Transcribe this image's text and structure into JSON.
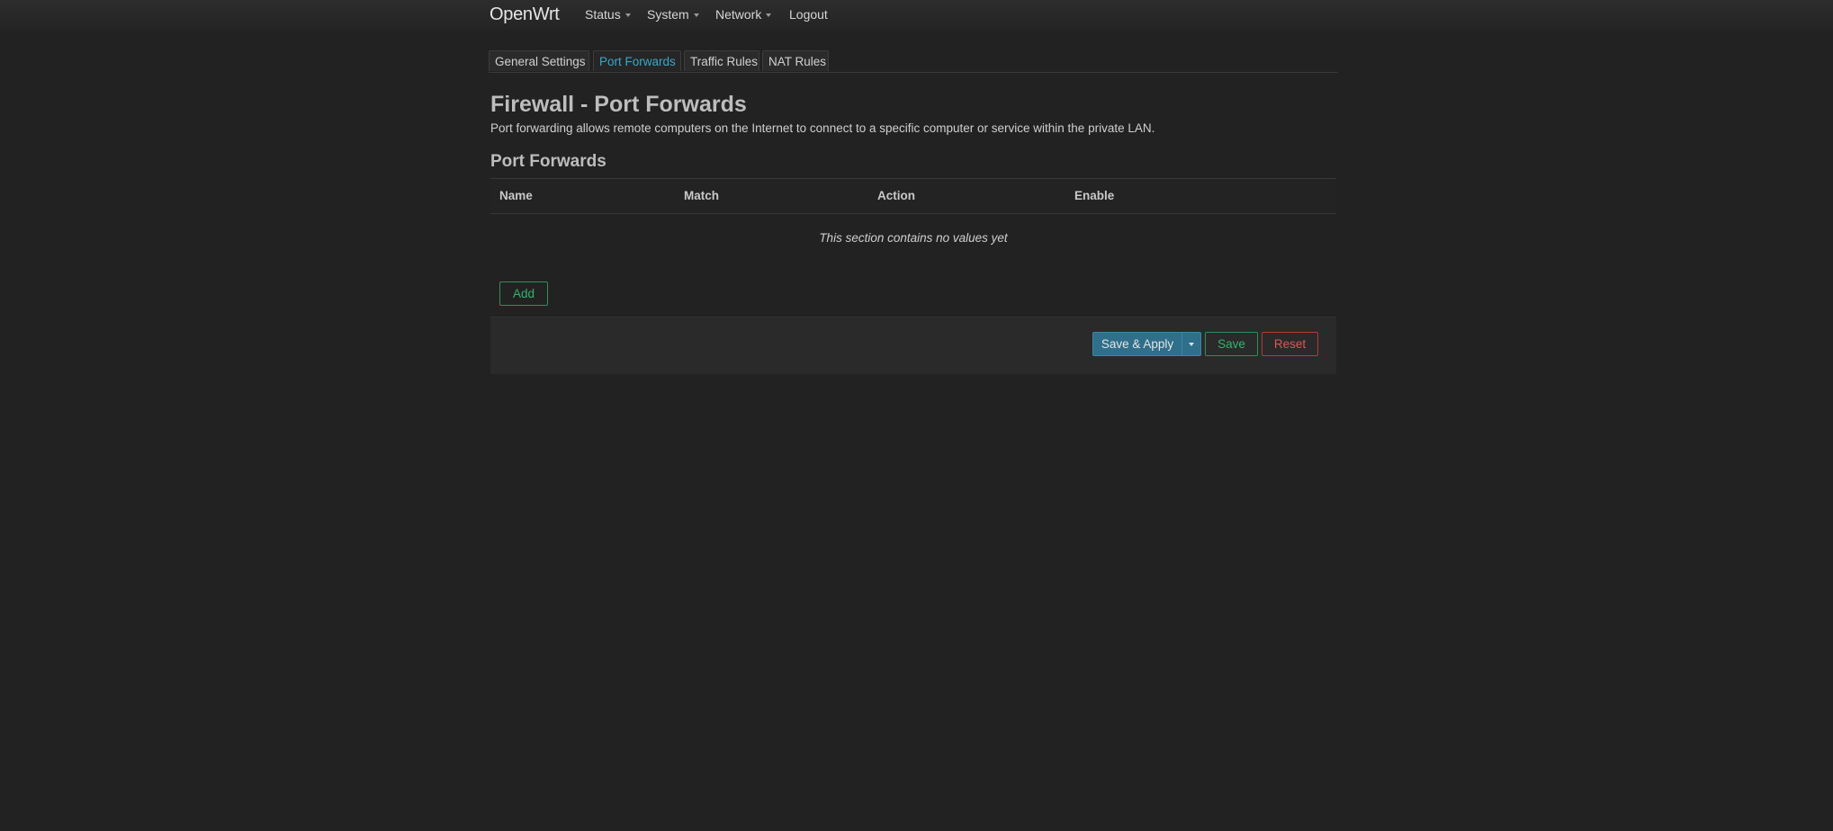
{
  "header": {
    "brand": "OpenWrt",
    "menu": [
      {
        "label": "Status"
      },
      {
        "label": "System"
      },
      {
        "label": "Network"
      },
      {
        "label": "Logout"
      }
    ]
  },
  "tabs": [
    {
      "label": "General Settings"
    },
    {
      "label": "Port Forwards",
      "active": true
    },
    {
      "label": "Traffic Rules"
    },
    {
      "label": "NAT Rules"
    }
  ],
  "page": {
    "title": "Firewall - Port Forwards",
    "description": "Port forwarding allows remote computers on the Internet to connect to a specific computer or service within the private LAN."
  },
  "section": {
    "title": "Port Forwards",
    "columns": [
      "Name",
      "Match",
      "Action",
      "Enable"
    ],
    "empty_text": "This section contains no values yet",
    "add_label": "Add"
  },
  "actions": {
    "save_apply_label": "Save & Apply",
    "save_label": "Save",
    "reset_label": "Reset"
  },
  "colors": {
    "background": "#222222",
    "accent": "#3aa7c9",
    "positive": "#36b36f",
    "negative": "#e05555"
  }
}
